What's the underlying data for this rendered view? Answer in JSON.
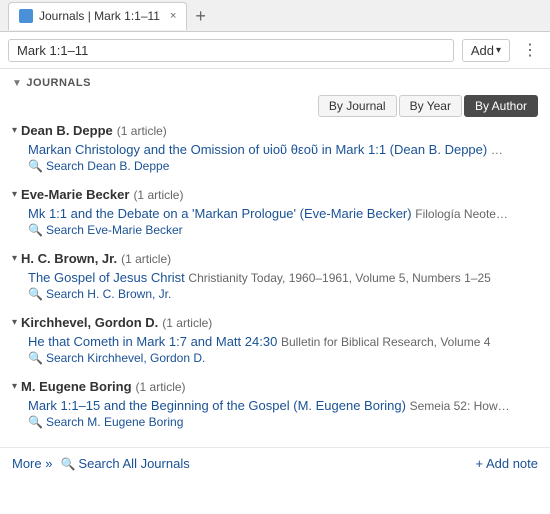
{
  "tab": {
    "favicon_label": "J",
    "title": "Journals | Mark 1:1–11",
    "close_label": "×"
  },
  "new_tab_label": "+",
  "address_bar": {
    "value": "Mark 1:1–11",
    "add_label": "Add",
    "add_chevron": "▾",
    "more_label": "⋮"
  },
  "section": {
    "chevron": "▼",
    "label": "JOURNALS"
  },
  "filter_tabs": [
    {
      "label": "By Journal",
      "active": false
    },
    {
      "label": "By Year",
      "active": false
    },
    {
      "label": "By Author",
      "active": true
    }
  ],
  "authors": [
    {
      "name": "Dean B. Deppe",
      "count": "(1 article)",
      "articles": [
        {
          "title": "Markan Christology and the Omission of υἱοῦ θεοῦ in Mark 1:1 (Dean B. Deppe)",
          "meta": "…"
        }
      ],
      "search_label": "Search Dean B. Deppe"
    },
    {
      "name": "Eve-Marie Becker",
      "count": "(1 article)",
      "articles": [
        {
          "title": "Mk 1:1 and the Debate on a 'Markan Prologue' (Eve-Marie Becker)",
          "meta": "Filología Neote…"
        }
      ],
      "search_label": "Search Eve-Marie Becker"
    },
    {
      "name": "H. C. Brown, Jr.",
      "count": "(1 article)",
      "articles": [
        {
          "title": "The Gospel of Jesus Christ",
          "meta": "Christianity Today, 1960–1961, Volume 5, Numbers 1–25"
        }
      ],
      "search_label": "Search H. C. Brown, Jr."
    },
    {
      "name": "Kirchhevel, Gordon D.",
      "count": "(1 article)",
      "articles": [
        {
          "title": "He that Cometh in Mark 1:7 and Matt 24:30",
          "meta": "Bulletin for Biblical Research, Volume 4"
        }
      ],
      "search_label": "Search Kirchhevel, Gordon D."
    },
    {
      "name": "M. Eugene Boring",
      "count": "(1 article)",
      "articles": [
        {
          "title": "Mark 1:1–15 and the Beginning of the Gospel (M. Eugene Boring)",
          "meta": "Semeia 52: How…"
        }
      ],
      "search_label": "Search M. Eugene Boring"
    }
  ],
  "footer": {
    "more_label": "More »",
    "search_all_label": "Search All Journals",
    "add_note_label": "+ Add note"
  }
}
